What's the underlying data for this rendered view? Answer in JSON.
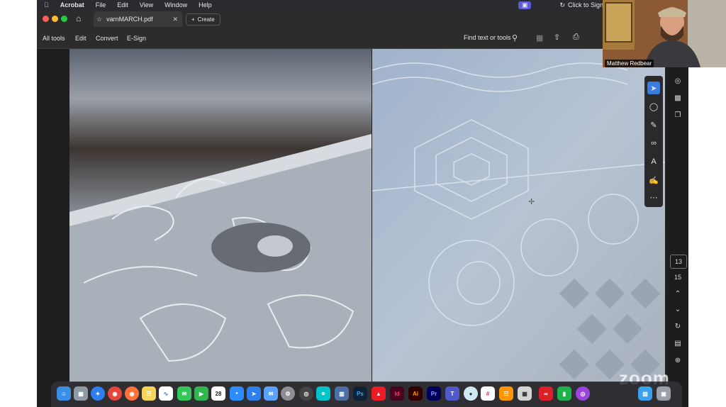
{
  "menubar": {
    "app": "Acrobat",
    "items": [
      "File",
      "Edit",
      "View",
      "Window",
      "Help"
    ],
    "sign_in": "Click to Sign in"
  },
  "tabbar": {
    "tab_title": "varnMARCH.pdf",
    "create_label": "Create"
  },
  "toolbar": {
    "items": [
      "All tools",
      "Edit",
      "Convert",
      "E-Sign"
    ],
    "find_label": "Find text or tools"
  },
  "sidepanel": {
    "page_current": "13",
    "page_total": "15"
  },
  "video": {
    "participant_name": "Matthew Redbear"
  },
  "watermark": "zoom",
  "dock": {
    "apps": [
      "finder-icon",
      "launchpad-icon",
      "safari-icon",
      "chrome-icon",
      "firefox-icon",
      "notes-icon",
      "freeform-icon",
      "messages-icon",
      "facetime-icon",
      "calendar-icon",
      "zoom-icon",
      "mail-icon",
      "settings-icon",
      "photoshop-icon",
      "acrobat-icon",
      "indesign-icon",
      "illustrator-icon",
      "premiere-icon",
      "teams-icon",
      "slack-icon",
      "books-icon",
      "numbers-icon",
      "podcasts-icon",
      "downloads-icon",
      "trash-icon"
    ],
    "calendar_day": "28",
    "ps": "Ps",
    "id": "Id",
    "ai": "Ai",
    "pr": "Pr"
  }
}
